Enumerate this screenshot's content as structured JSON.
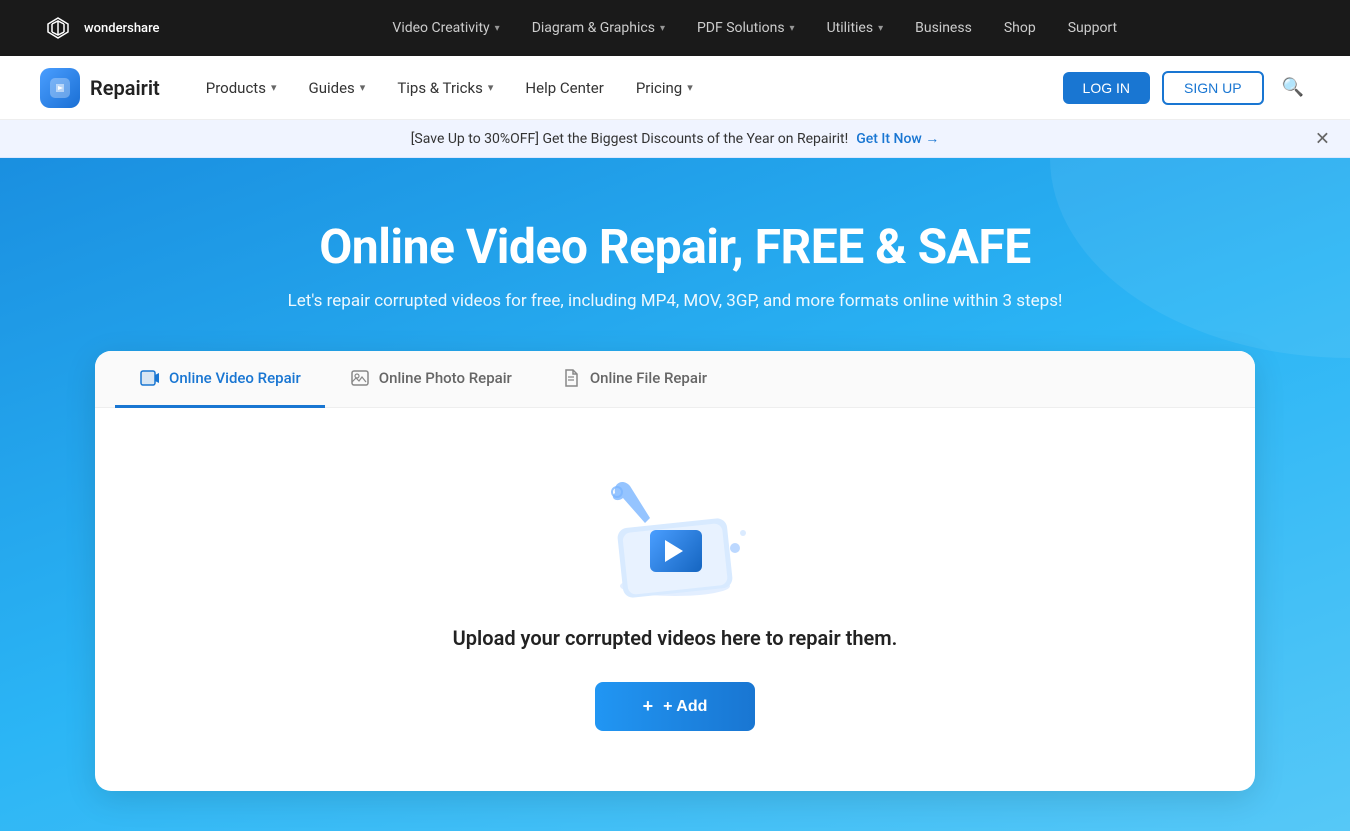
{
  "topnav": {
    "logo_text": "wondershare",
    "items": [
      {
        "label": "Video Creativity",
        "has_dropdown": true
      },
      {
        "label": "Diagram & Graphics",
        "has_dropdown": true
      },
      {
        "label": "PDF Solutions",
        "has_dropdown": true
      },
      {
        "label": "Utilities",
        "has_dropdown": true
      },
      {
        "label": "Business",
        "has_dropdown": false
      },
      {
        "label": "Shop",
        "has_dropdown": false
      },
      {
        "label": "Support",
        "has_dropdown": false
      }
    ]
  },
  "secondnav": {
    "brand_name": "Repairit",
    "items": [
      {
        "label": "Products",
        "has_dropdown": true
      },
      {
        "label": "Guides",
        "has_dropdown": true
      },
      {
        "label": "Tips & Tricks",
        "has_dropdown": true
      },
      {
        "label": "Help Center",
        "has_dropdown": false
      },
      {
        "label": "Pricing",
        "has_dropdown": true
      }
    ],
    "login_label": "LOG IN",
    "signup_label": "SIGN UP"
  },
  "banner": {
    "text": "[Save Up to 30%OFF] Get the Biggest Discounts of the Year on Repairit!",
    "link_text": "Get It Now →"
  },
  "hero": {
    "title": "Online Video Repair, FREE & SAFE",
    "subtitle": "Let's repair corrupted videos for free, including MP4, MOV, 3GP, and more formats online within 3 steps!"
  },
  "card": {
    "tabs": [
      {
        "label": "Online Video Repair",
        "active": true,
        "icon": "🎬"
      },
      {
        "label": "Online Photo Repair",
        "active": false,
        "icon": "🖼"
      },
      {
        "label": "Online File Repair",
        "active": false,
        "icon": "📄"
      }
    ],
    "upload_text": "Upload your corrupted videos here to repair them.",
    "add_button_label": "+ Add"
  }
}
